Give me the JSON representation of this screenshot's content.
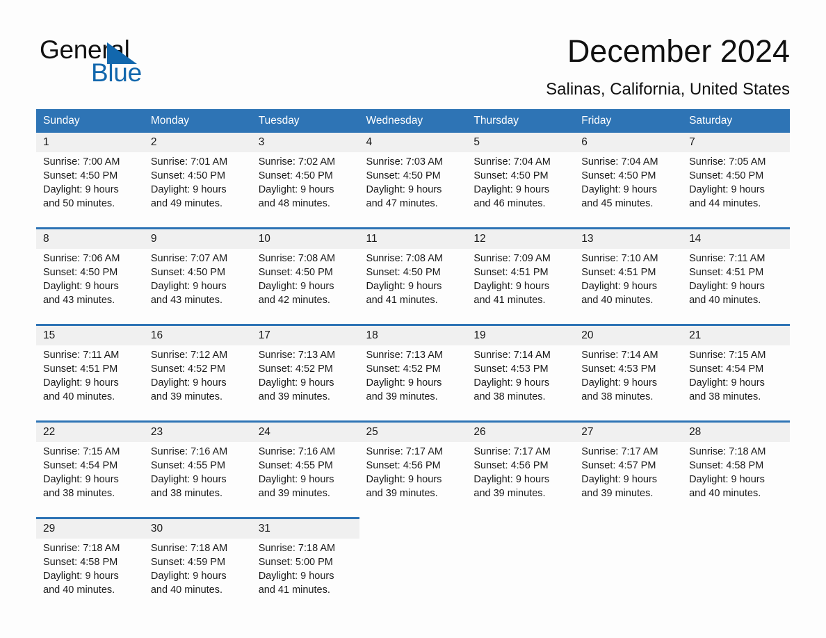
{
  "brand": {
    "name_part1": "General",
    "name_part2": "Blue"
  },
  "header": {
    "month_title": "December 2024",
    "location": "Salinas, California, United States"
  },
  "colors": {
    "header_blue": "#2e74b5",
    "brand_blue": "#1267ad",
    "daynum_band": "#f0f0f0",
    "page_background": "#fdfdfd"
  },
  "calendar": {
    "weekday_headers": [
      "Sunday",
      "Monday",
      "Tuesday",
      "Wednesday",
      "Thursday",
      "Friday",
      "Saturday"
    ],
    "weeks": [
      [
        {
          "day": "1",
          "sunrise": "Sunrise: 7:00 AM",
          "sunset": "Sunset: 4:50 PM",
          "daylight_line1": "Daylight: 9 hours",
          "daylight_line2": "and 50 minutes."
        },
        {
          "day": "2",
          "sunrise": "Sunrise: 7:01 AM",
          "sunset": "Sunset: 4:50 PM",
          "daylight_line1": "Daylight: 9 hours",
          "daylight_line2": "and 49 minutes."
        },
        {
          "day": "3",
          "sunrise": "Sunrise: 7:02 AM",
          "sunset": "Sunset: 4:50 PM",
          "daylight_line1": "Daylight: 9 hours",
          "daylight_line2": "and 48 minutes."
        },
        {
          "day": "4",
          "sunrise": "Sunrise: 7:03 AM",
          "sunset": "Sunset: 4:50 PM",
          "daylight_line1": "Daylight: 9 hours",
          "daylight_line2": "and 47 minutes."
        },
        {
          "day": "5",
          "sunrise": "Sunrise: 7:04 AM",
          "sunset": "Sunset: 4:50 PM",
          "daylight_line1": "Daylight: 9 hours",
          "daylight_line2": "and 46 minutes."
        },
        {
          "day": "6",
          "sunrise": "Sunrise: 7:04 AM",
          "sunset": "Sunset: 4:50 PM",
          "daylight_line1": "Daylight: 9 hours",
          "daylight_line2": "and 45 minutes."
        },
        {
          "day": "7",
          "sunrise": "Sunrise: 7:05 AM",
          "sunset": "Sunset: 4:50 PM",
          "daylight_line1": "Daylight: 9 hours",
          "daylight_line2": "and 44 minutes."
        }
      ],
      [
        {
          "day": "8",
          "sunrise": "Sunrise: 7:06 AM",
          "sunset": "Sunset: 4:50 PM",
          "daylight_line1": "Daylight: 9 hours",
          "daylight_line2": "and 43 minutes."
        },
        {
          "day": "9",
          "sunrise": "Sunrise: 7:07 AM",
          "sunset": "Sunset: 4:50 PM",
          "daylight_line1": "Daylight: 9 hours",
          "daylight_line2": "and 43 minutes."
        },
        {
          "day": "10",
          "sunrise": "Sunrise: 7:08 AM",
          "sunset": "Sunset: 4:50 PM",
          "daylight_line1": "Daylight: 9 hours",
          "daylight_line2": "and 42 minutes."
        },
        {
          "day": "11",
          "sunrise": "Sunrise: 7:08 AM",
          "sunset": "Sunset: 4:50 PM",
          "daylight_line1": "Daylight: 9 hours",
          "daylight_line2": "and 41 minutes."
        },
        {
          "day": "12",
          "sunrise": "Sunrise: 7:09 AM",
          "sunset": "Sunset: 4:51 PM",
          "daylight_line1": "Daylight: 9 hours",
          "daylight_line2": "and 41 minutes."
        },
        {
          "day": "13",
          "sunrise": "Sunrise: 7:10 AM",
          "sunset": "Sunset: 4:51 PM",
          "daylight_line1": "Daylight: 9 hours",
          "daylight_line2": "and 40 minutes."
        },
        {
          "day": "14",
          "sunrise": "Sunrise: 7:11 AM",
          "sunset": "Sunset: 4:51 PM",
          "daylight_line1": "Daylight: 9 hours",
          "daylight_line2": "and 40 minutes."
        }
      ],
      [
        {
          "day": "15",
          "sunrise": "Sunrise: 7:11 AM",
          "sunset": "Sunset: 4:51 PM",
          "daylight_line1": "Daylight: 9 hours",
          "daylight_line2": "and 40 minutes."
        },
        {
          "day": "16",
          "sunrise": "Sunrise: 7:12 AM",
          "sunset": "Sunset: 4:52 PM",
          "daylight_line1": "Daylight: 9 hours",
          "daylight_line2": "and 39 minutes."
        },
        {
          "day": "17",
          "sunrise": "Sunrise: 7:13 AM",
          "sunset": "Sunset: 4:52 PM",
          "daylight_line1": "Daylight: 9 hours",
          "daylight_line2": "and 39 minutes."
        },
        {
          "day": "18",
          "sunrise": "Sunrise: 7:13 AM",
          "sunset": "Sunset: 4:52 PM",
          "daylight_line1": "Daylight: 9 hours",
          "daylight_line2": "and 39 minutes."
        },
        {
          "day": "19",
          "sunrise": "Sunrise: 7:14 AM",
          "sunset": "Sunset: 4:53 PM",
          "daylight_line1": "Daylight: 9 hours",
          "daylight_line2": "and 38 minutes."
        },
        {
          "day": "20",
          "sunrise": "Sunrise: 7:14 AM",
          "sunset": "Sunset: 4:53 PM",
          "daylight_line1": "Daylight: 9 hours",
          "daylight_line2": "and 38 minutes."
        },
        {
          "day": "21",
          "sunrise": "Sunrise: 7:15 AM",
          "sunset": "Sunset: 4:54 PM",
          "daylight_line1": "Daylight: 9 hours",
          "daylight_line2": "and 38 minutes."
        }
      ],
      [
        {
          "day": "22",
          "sunrise": "Sunrise: 7:15 AM",
          "sunset": "Sunset: 4:54 PM",
          "daylight_line1": "Daylight: 9 hours",
          "daylight_line2": "and 38 minutes."
        },
        {
          "day": "23",
          "sunrise": "Sunrise: 7:16 AM",
          "sunset": "Sunset: 4:55 PM",
          "daylight_line1": "Daylight: 9 hours",
          "daylight_line2": "and 38 minutes."
        },
        {
          "day": "24",
          "sunrise": "Sunrise: 7:16 AM",
          "sunset": "Sunset: 4:55 PM",
          "daylight_line1": "Daylight: 9 hours",
          "daylight_line2": "and 39 minutes."
        },
        {
          "day": "25",
          "sunrise": "Sunrise: 7:17 AM",
          "sunset": "Sunset: 4:56 PM",
          "daylight_line1": "Daylight: 9 hours",
          "daylight_line2": "and 39 minutes."
        },
        {
          "day": "26",
          "sunrise": "Sunrise: 7:17 AM",
          "sunset": "Sunset: 4:56 PM",
          "daylight_line1": "Daylight: 9 hours",
          "daylight_line2": "and 39 minutes."
        },
        {
          "day": "27",
          "sunrise": "Sunrise: 7:17 AM",
          "sunset": "Sunset: 4:57 PM",
          "daylight_line1": "Daylight: 9 hours",
          "daylight_line2": "and 39 minutes."
        },
        {
          "day": "28",
          "sunrise": "Sunrise: 7:18 AM",
          "sunset": "Sunset: 4:58 PM",
          "daylight_line1": "Daylight: 9 hours",
          "daylight_line2": "and 40 minutes."
        }
      ],
      [
        {
          "day": "29",
          "sunrise": "Sunrise: 7:18 AM",
          "sunset": "Sunset: 4:58 PM",
          "daylight_line1": "Daylight: 9 hours",
          "daylight_line2": "and 40 minutes."
        },
        {
          "day": "30",
          "sunrise": "Sunrise: 7:18 AM",
          "sunset": "Sunset: 4:59 PM",
          "daylight_line1": "Daylight: 9 hours",
          "daylight_line2": "and 40 minutes."
        },
        {
          "day": "31",
          "sunrise": "Sunrise: 7:18 AM",
          "sunset": "Sunset: 5:00 PM",
          "daylight_line1": "Daylight: 9 hours",
          "daylight_line2": "and 41 minutes."
        },
        {
          "day": "",
          "sunrise": "",
          "sunset": "",
          "daylight_line1": "",
          "daylight_line2": ""
        },
        {
          "day": "",
          "sunrise": "",
          "sunset": "",
          "daylight_line1": "",
          "daylight_line2": ""
        },
        {
          "day": "",
          "sunrise": "",
          "sunset": "",
          "daylight_line1": "",
          "daylight_line2": ""
        },
        {
          "day": "",
          "sunrise": "",
          "sunset": "",
          "daylight_line1": "",
          "daylight_line2": ""
        }
      ]
    ]
  }
}
